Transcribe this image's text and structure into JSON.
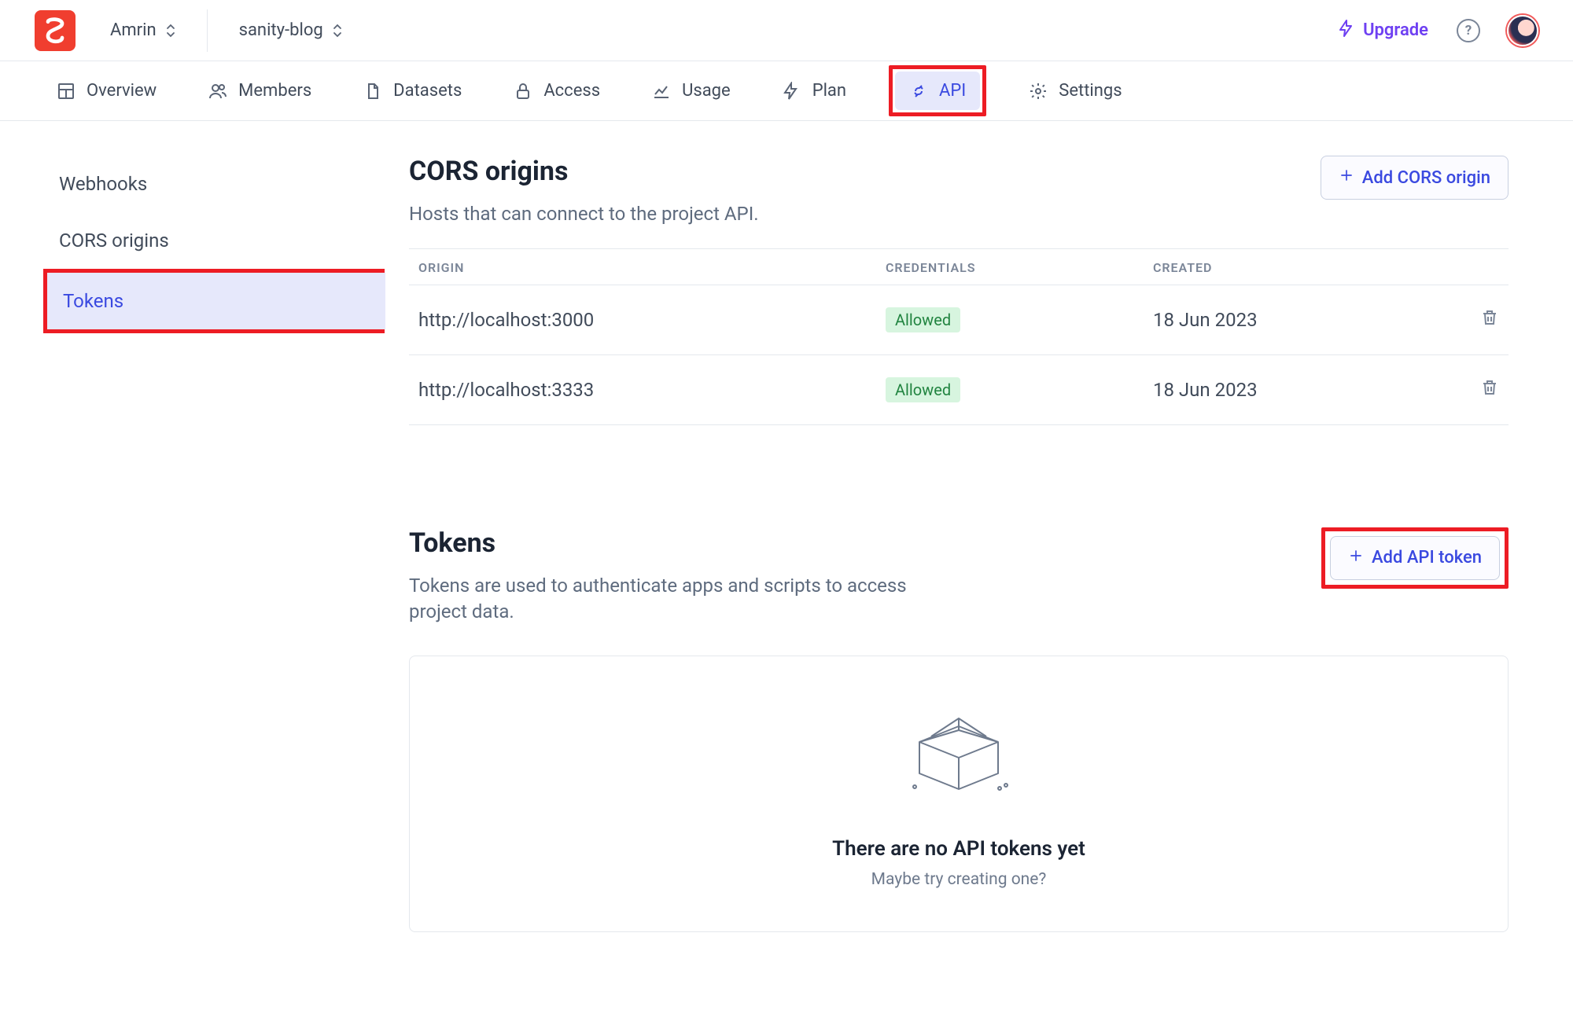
{
  "topbar": {
    "user_switch": "Amrin",
    "project_switch": "sanity-blog",
    "upgrade": "Upgrade"
  },
  "tabs": {
    "overview": "Overview",
    "members": "Members",
    "datasets": "Datasets",
    "access": "Access",
    "usage": "Usage",
    "plan": "Plan",
    "api": "API",
    "settings": "Settings"
  },
  "sidebar": {
    "webhooks": "Webhooks",
    "cors": "CORS origins",
    "tokens": "Tokens"
  },
  "cors": {
    "title": "CORS origins",
    "desc": "Hosts that can connect to the project API.",
    "add_btn": "Add CORS origin",
    "headers": {
      "origin": "ORIGIN",
      "credentials": "CREDENTIALS",
      "created": "CREATED"
    },
    "rows": [
      {
        "origin": "http://localhost:3000",
        "credentials": "Allowed",
        "created": "18 Jun 2023"
      },
      {
        "origin": "http://localhost:3333",
        "credentials": "Allowed",
        "created": "18 Jun 2023"
      }
    ]
  },
  "tokens": {
    "title": "Tokens",
    "desc": "Tokens are used to authenticate apps and scripts to access project data.",
    "add_btn": "Add API token",
    "empty_title": "There are no API tokens yet",
    "empty_sub": "Maybe try creating one?"
  }
}
